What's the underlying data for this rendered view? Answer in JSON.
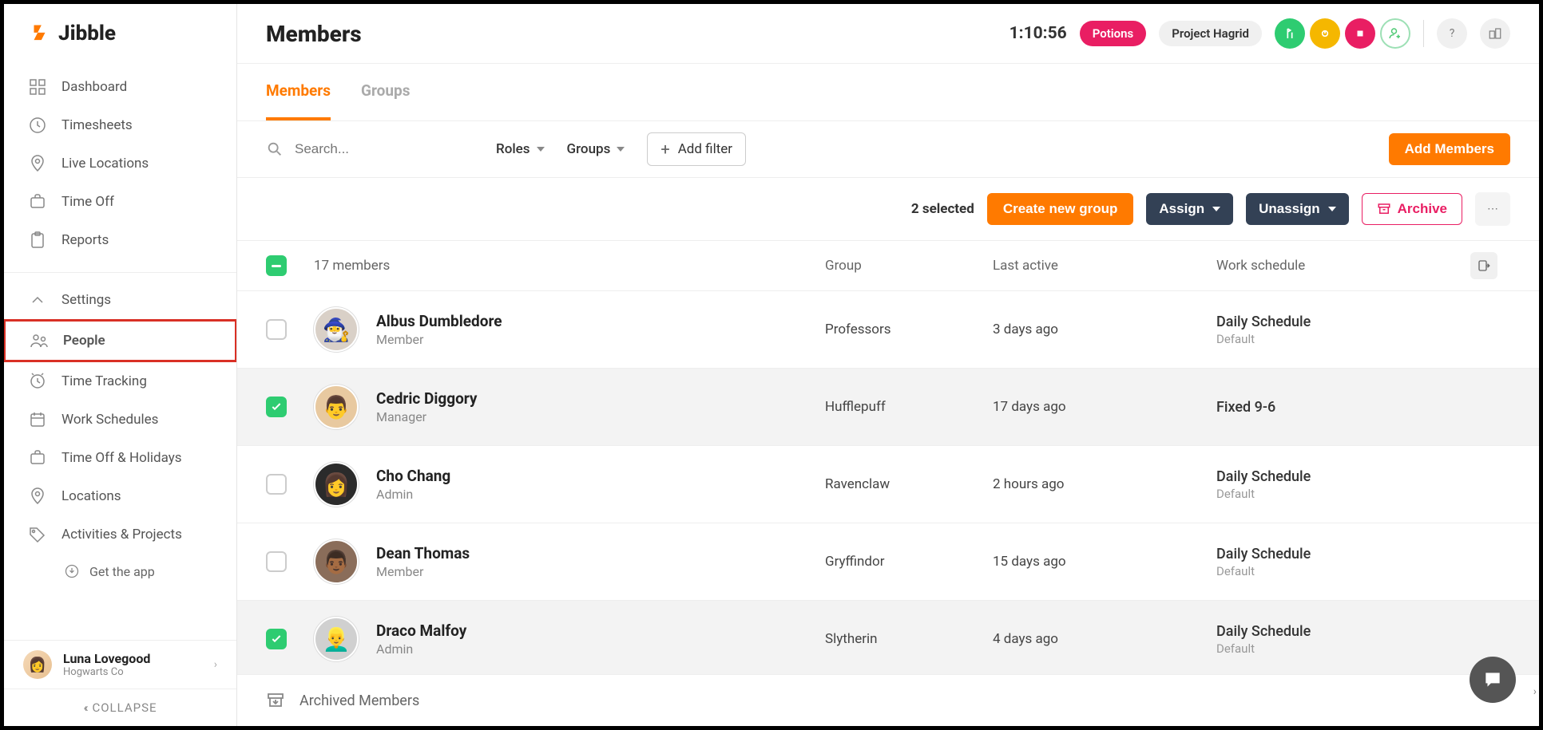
{
  "logo_text": "Jibble",
  "sidebar": {
    "items": [
      {
        "label": "Dashboard"
      },
      {
        "label": "Timesheets"
      },
      {
        "label": "Live Locations"
      },
      {
        "label": "Time Off"
      },
      {
        "label": "Reports"
      }
    ],
    "settings_label": "Settings",
    "items2": [
      {
        "label": "People"
      },
      {
        "label": "Time Tracking"
      },
      {
        "label": "Work Schedules"
      },
      {
        "label": "Time Off & Holidays"
      },
      {
        "label": "Locations"
      },
      {
        "label": "Activities & Projects"
      }
    ],
    "get_app": "Get the app",
    "collapse": "COLLAPSE"
  },
  "user": {
    "name": "Luna Lovegood",
    "org": "Hogwarts Co"
  },
  "header": {
    "title": "Members",
    "timer": "1:10:56",
    "chip_pink": "Potions",
    "chip_grey": "Project Hagrid"
  },
  "tabs": {
    "members": "Members",
    "groups": "Groups"
  },
  "filters": {
    "search_placeholder": "Search...",
    "roles": "Roles",
    "groups": "Groups",
    "add_filter": "Add filter",
    "add_members": "Add Members"
  },
  "actions": {
    "selected": "2 selected",
    "create_group": "Create new group",
    "assign": "Assign",
    "unassign": "Unassign",
    "archive": "Archive"
  },
  "table": {
    "count_label": "17 members",
    "cols": {
      "group": "Group",
      "last_active": "Last active",
      "schedule": "Work schedule"
    },
    "rows": [
      {
        "name": "Albus Dumbledore",
        "role": "Member",
        "group": "Professors",
        "last_active": "3 days ago",
        "schedule": "Daily Schedule",
        "schedule_sub": "Default",
        "checked": false,
        "emoji": "🧙‍♂️",
        "bg": "#d9d0c7"
      },
      {
        "name": "Cedric Diggory",
        "role": "Manager",
        "group": "Hufflepuff",
        "last_active": "17 days ago",
        "schedule": "Fixed 9-6",
        "schedule_sub": "",
        "checked": true,
        "emoji": "👨",
        "bg": "#e8c9a0"
      },
      {
        "name": "Cho Chang",
        "role": "Admin",
        "group": "Ravenclaw",
        "last_active": "2 hours ago",
        "schedule": "Daily Schedule",
        "schedule_sub": "Default",
        "checked": false,
        "emoji": "👩",
        "bg": "#2b2b2b"
      },
      {
        "name": "Dean Thomas",
        "role": "Member",
        "group": "Gryffindor",
        "last_active": "15 days ago",
        "schedule": "Daily Schedule",
        "schedule_sub": "Default",
        "checked": false,
        "emoji": "👨🏾",
        "bg": "#8a6d5a"
      },
      {
        "name": "Draco Malfoy",
        "role": "Admin",
        "group": "Slytherin",
        "last_active": "4 days ago",
        "schedule": "Daily Schedule",
        "schedule_sub": "Default",
        "checked": true,
        "emoji": "👱‍♂️",
        "bg": "#d0d0d0"
      }
    ]
  },
  "archived_label": "Archived Members"
}
